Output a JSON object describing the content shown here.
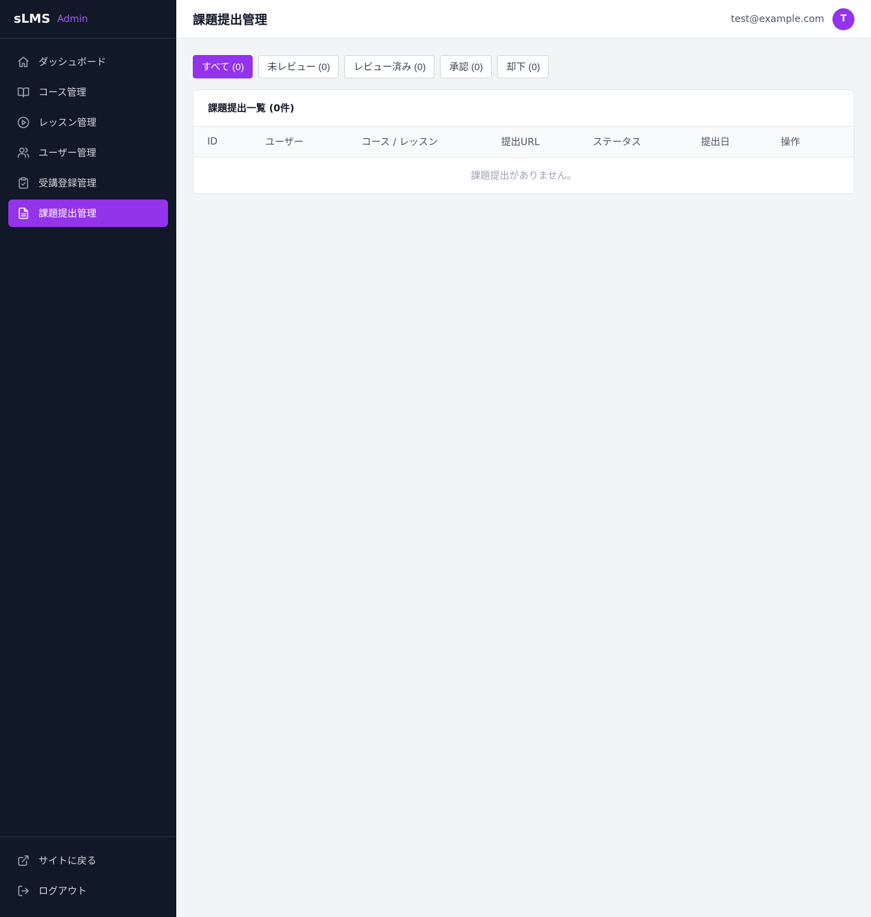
{
  "brand": {
    "name": "sLMS",
    "tag": "Admin"
  },
  "sidebar": {
    "items": [
      {
        "label": "ダッシュボード",
        "icon": "home-icon"
      },
      {
        "label": "コース管理",
        "icon": "book-open-icon"
      },
      {
        "label": "レッスン管理",
        "icon": "play-circle-icon"
      },
      {
        "label": "ユーザー管理",
        "icon": "users-icon"
      },
      {
        "label": "受講登録管理",
        "icon": "clipboard-check-icon"
      },
      {
        "label": "課題提出管理",
        "icon": "file-text-icon",
        "active": true
      }
    ],
    "bottom": [
      {
        "label": "サイトに戻る",
        "icon": "external-link-icon"
      },
      {
        "label": "ログアウト",
        "icon": "log-out-icon"
      }
    ]
  },
  "header": {
    "title": "課題提出管理",
    "user_email": "test@example.com",
    "avatar_initial": "T"
  },
  "filters": [
    {
      "label": "すべて (0)",
      "active": true
    },
    {
      "label": "未レビュー (0)"
    },
    {
      "label": "レビュー済み (0)"
    },
    {
      "label": "承認 (0)"
    },
    {
      "label": "却下 (0)"
    }
  ],
  "table": {
    "title": "課題提出一覧 (0件)",
    "columns": [
      "ID",
      "ユーザー",
      "コース / レッスン",
      "提出URL",
      "ステータス",
      "提出日",
      "操作"
    ],
    "empty_message": "課題提出がありません。"
  },
  "colors": {
    "accent": "#9333ea",
    "sidebar_bg": "#111827",
    "brand_tag": "#a855f7"
  }
}
